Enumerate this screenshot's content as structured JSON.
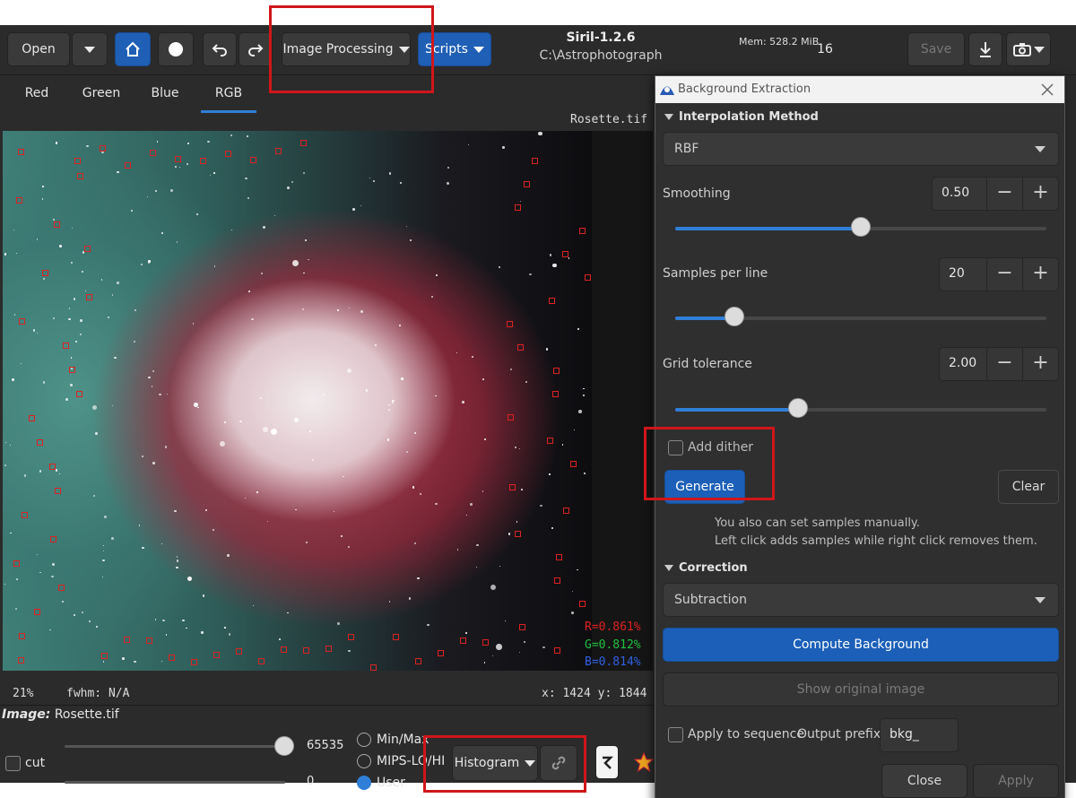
{
  "toolbar": {
    "open_label": "Open",
    "image_processing_label": "Image Processing",
    "scripts_label": "Scripts",
    "app_title": "Siril-1.2.6",
    "app_path": "C:\\Astrophotograph",
    "memory": "Mem: 528.2 MiB",
    "bit_depth": "16",
    "save_label": "Save",
    "minus": "−",
    "plus": "+"
  },
  "tabs": [
    "Red",
    "Green",
    "Blue",
    "RGB"
  ],
  "image_view": {
    "filename": "Rosette.tif",
    "r_value": "R=0.861%",
    "g_value": "G=0.812%",
    "b_value": "B=0.814%",
    "colors": {
      "r": "#e02020",
      "g": "#20c040",
      "b": "#3060e0"
    }
  },
  "statusbar": {
    "zoom": "21%",
    "fwhm": "fwhm: N/A",
    "coords": "x: 1424  y: 1844"
  },
  "bottom_panel": {
    "image_label": "Image:",
    "image_name": "Rosette.tif",
    "cut_label": "cut",
    "high_value": "65535",
    "low_value": "0",
    "radio_options": [
      "Min/Max",
      "MIPS-LO/HI",
      "User"
    ],
    "histogram_label": "Histogram"
  },
  "dialog": {
    "title": "Background Extraction",
    "interpolation_header": "Interpolation Method",
    "interpolation_value": "RBF",
    "smoothing_label": "Smoothing",
    "smoothing_value": "0.50",
    "smoothing_level": 0.5,
    "samples_label": "Samples per line",
    "samples_value": "20",
    "samples_level": 0.16,
    "tolerance_label": "Grid tolerance",
    "tolerance_value": "2.00",
    "tolerance_level": 0.33,
    "add_dither_label": "Add dither",
    "generate_label": "Generate",
    "clear_label": "Clear",
    "hint_line1": "You also can set samples manually.",
    "hint_line2": "Left click adds samples while right click removes them.",
    "correction_header": "Correction",
    "correction_value": "Subtraction",
    "compute_label": "Compute Background",
    "show_original_label": "Show original image",
    "apply_sequence_label": "Apply to sequence",
    "output_prefix_label": "Output prefix:",
    "output_prefix_value": "bkg_",
    "close_label": "Close",
    "apply_label": "Apply"
  },
  "accent_color": "#1f5fb5",
  "highlight_color": "#d0161a"
}
